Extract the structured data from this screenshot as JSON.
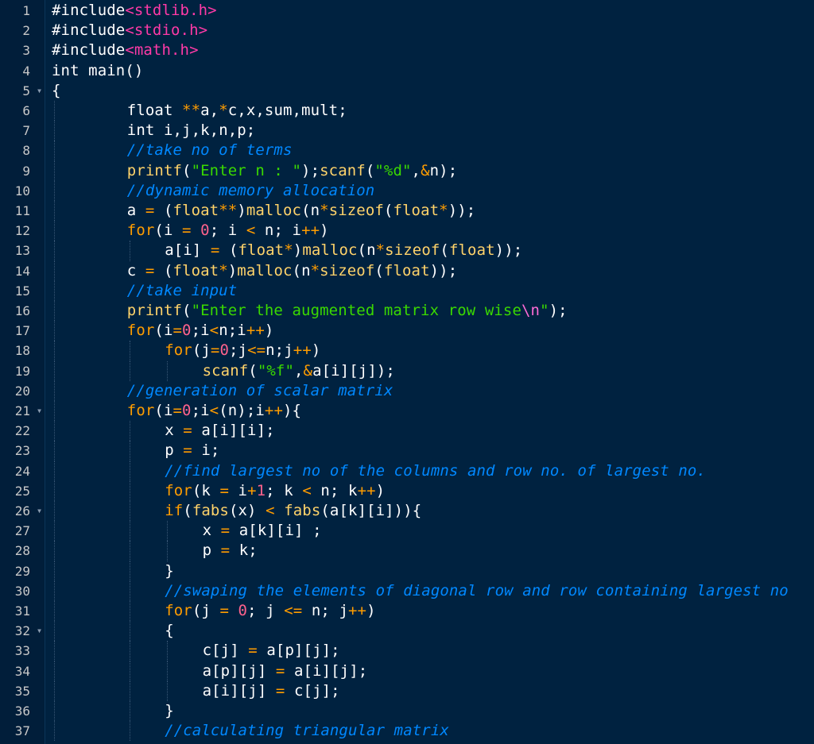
{
  "editor": {
    "theme_colors": {
      "background": "#002240",
      "gutter": "#011e3a",
      "text": "#ffffff",
      "keyword": "#ff9d00",
      "function": "#ffd36a",
      "string": "#3ad900",
      "number": "#ff628c",
      "header": "#ff3aa7",
      "comment": "#0088ff"
    },
    "lines": [
      {
        "number": "1",
        "fold": false,
        "indent": 0,
        "tokens": [
          {
            "t": "#include",
            "c": "preprocessor"
          },
          {
            "t": "<stdlib.h>",
            "c": "header"
          }
        ]
      },
      {
        "number": "2",
        "fold": false,
        "indent": 0,
        "tokens": [
          {
            "t": "#include",
            "c": "preprocessor"
          },
          {
            "t": "<stdio.h>",
            "c": "header"
          }
        ]
      },
      {
        "number": "3",
        "fold": false,
        "indent": 0,
        "tokens": [
          {
            "t": "#include",
            "c": "preprocessor"
          },
          {
            "t": "<math.h>",
            "c": "header"
          }
        ]
      },
      {
        "number": "4",
        "fold": false,
        "indent": 0,
        "tokens": [
          {
            "t": "int",
            "c": "type"
          },
          {
            "t": " ",
            "c": "text"
          },
          {
            "t": "main",
            "c": "identifier"
          },
          {
            "t": "()",
            "c": "text"
          }
        ]
      },
      {
        "number": "5",
        "fold": true,
        "indent": 0,
        "tokens": [
          {
            "t": "{",
            "c": "text"
          }
        ]
      },
      {
        "number": "6",
        "fold": false,
        "indent": 2,
        "tokens": [
          {
            "t": "float",
            "c": "type"
          },
          {
            "t": " ",
            "c": "text"
          },
          {
            "t": "**",
            "c": "operator"
          },
          {
            "t": "a,",
            "c": "text"
          },
          {
            "t": "*",
            "c": "operator"
          },
          {
            "t": "c,x,sum,mult;",
            "c": "text"
          }
        ]
      },
      {
        "number": "7",
        "fold": false,
        "indent": 2,
        "tokens": [
          {
            "t": "int",
            "c": "type"
          },
          {
            "t": " i,j,k,n,p;",
            "c": "text"
          }
        ]
      },
      {
        "number": "8",
        "fold": false,
        "indent": 2,
        "tokens": [
          {
            "t": "//take no of terms",
            "c": "comment"
          }
        ]
      },
      {
        "number": "9",
        "fold": false,
        "indent": 2,
        "tokens": [
          {
            "t": "printf",
            "c": "function"
          },
          {
            "t": "(",
            "c": "text"
          },
          {
            "t": "\"Enter n : \"",
            "c": "string"
          },
          {
            "t": ");",
            "c": "text"
          },
          {
            "t": "scanf",
            "c": "function"
          },
          {
            "t": "(",
            "c": "text"
          },
          {
            "t": "\"%d\"",
            "c": "string"
          },
          {
            "t": ",",
            "c": "text"
          },
          {
            "t": "&",
            "c": "operator"
          },
          {
            "t": "n);",
            "c": "text"
          }
        ]
      },
      {
        "number": "10",
        "fold": false,
        "indent": 2,
        "tokens": [
          {
            "t": "//dynamic memory allocation",
            "c": "comment"
          }
        ]
      },
      {
        "number": "11",
        "fold": false,
        "indent": 2,
        "tokens": [
          {
            "t": "a ",
            "c": "text"
          },
          {
            "t": "=",
            "c": "operator"
          },
          {
            "t": " (",
            "c": "text"
          },
          {
            "t": "float",
            "c": "function"
          },
          {
            "t": "**",
            "c": "operator"
          },
          {
            "t": ")",
            "c": "text"
          },
          {
            "t": "malloc",
            "c": "function"
          },
          {
            "t": "(n",
            "c": "text"
          },
          {
            "t": "*",
            "c": "operator"
          },
          {
            "t": "sizeof",
            "c": "function"
          },
          {
            "t": "(",
            "c": "text"
          },
          {
            "t": "float",
            "c": "function"
          },
          {
            "t": "*",
            "c": "operator"
          },
          {
            "t": "));",
            "c": "text"
          }
        ]
      },
      {
        "number": "12",
        "fold": false,
        "indent": 2,
        "tokens": [
          {
            "t": "for",
            "c": "keyword"
          },
          {
            "t": "(i ",
            "c": "text"
          },
          {
            "t": "=",
            "c": "operator"
          },
          {
            "t": " ",
            "c": "text"
          },
          {
            "t": "0",
            "c": "number"
          },
          {
            "t": "; i ",
            "c": "text"
          },
          {
            "t": "<",
            "c": "operator"
          },
          {
            "t": " n; i",
            "c": "text"
          },
          {
            "t": "++",
            "c": "operator"
          },
          {
            "t": ")",
            "c": "text"
          }
        ]
      },
      {
        "number": "13",
        "fold": false,
        "indent": 3,
        "tokens": [
          {
            "t": "a[i] ",
            "c": "text"
          },
          {
            "t": "=",
            "c": "operator"
          },
          {
            "t": " (",
            "c": "text"
          },
          {
            "t": "float",
            "c": "function"
          },
          {
            "t": "*",
            "c": "operator"
          },
          {
            "t": ")",
            "c": "text"
          },
          {
            "t": "malloc",
            "c": "function"
          },
          {
            "t": "(n",
            "c": "text"
          },
          {
            "t": "*",
            "c": "operator"
          },
          {
            "t": "sizeof",
            "c": "function"
          },
          {
            "t": "(",
            "c": "text"
          },
          {
            "t": "float",
            "c": "function"
          },
          {
            "t": "));",
            "c": "text"
          }
        ]
      },
      {
        "number": "14",
        "fold": false,
        "indent": 2,
        "tokens": [
          {
            "t": "c ",
            "c": "text"
          },
          {
            "t": "=",
            "c": "operator"
          },
          {
            "t": " (",
            "c": "text"
          },
          {
            "t": "float",
            "c": "function"
          },
          {
            "t": "*",
            "c": "operator"
          },
          {
            "t": ")",
            "c": "text"
          },
          {
            "t": "malloc",
            "c": "function"
          },
          {
            "t": "(n",
            "c": "text"
          },
          {
            "t": "*",
            "c": "operator"
          },
          {
            "t": "sizeof",
            "c": "function"
          },
          {
            "t": "(",
            "c": "text"
          },
          {
            "t": "float",
            "c": "function"
          },
          {
            "t": "));",
            "c": "text"
          }
        ]
      },
      {
        "number": "15",
        "fold": false,
        "indent": 2,
        "tokens": [
          {
            "t": "//take input",
            "c": "comment"
          }
        ]
      },
      {
        "number": "16",
        "fold": false,
        "indent": 2,
        "tokens": [
          {
            "t": "printf",
            "c": "function"
          },
          {
            "t": "(",
            "c": "text"
          },
          {
            "t": "\"Enter the augmented matrix row wise",
            "c": "string"
          },
          {
            "t": "\\n",
            "c": "escape"
          },
          {
            "t": "\"",
            "c": "string"
          },
          {
            "t": ");",
            "c": "text"
          }
        ]
      },
      {
        "number": "17",
        "fold": false,
        "indent": 2,
        "tokens": [
          {
            "t": "for",
            "c": "keyword"
          },
          {
            "t": "(i",
            "c": "text"
          },
          {
            "t": "=",
            "c": "operator"
          },
          {
            "t": "0",
            "c": "number"
          },
          {
            "t": ";i",
            "c": "text"
          },
          {
            "t": "<",
            "c": "operator"
          },
          {
            "t": "n;i",
            "c": "text"
          },
          {
            "t": "++",
            "c": "operator"
          },
          {
            "t": ")",
            "c": "text"
          }
        ]
      },
      {
        "number": "18",
        "fold": false,
        "indent": 3,
        "tokens": [
          {
            "t": "for",
            "c": "keyword"
          },
          {
            "t": "(j",
            "c": "text"
          },
          {
            "t": "=",
            "c": "operator"
          },
          {
            "t": "0",
            "c": "number"
          },
          {
            "t": ";j",
            "c": "text"
          },
          {
            "t": "<=",
            "c": "operator"
          },
          {
            "t": "n;j",
            "c": "text"
          },
          {
            "t": "++",
            "c": "operator"
          },
          {
            "t": ")",
            "c": "text"
          }
        ]
      },
      {
        "number": "19",
        "fold": false,
        "indent": 4,
        "tokens": [
          {
            "t": "scanf",
            "c": "function"
          },
          {
            "t": "(",
            "c": "text"
          },
          {
            "t": "\"%f\"",
            "c": "string"
          },
          {
            "t": ",",
            "c": "text"
          },
          {
            "t": "&",
            "c": "operator"
          },
          {
            "t": "a[i][j]);",
            "c": "text"
          }
        ]
      },
      {
        "number": "20",
        "fold": false,
        "indent": 2,
        "tokens": [
          {
            "t": "//generation of scalar matrix",
            "c": "comment"
          }
        ]
      },
      {
        "number": "21",
        "fold": true,
        "indent": 2,
        "tokens": [
          {
            "t": "for",
            "c": "keyword"
          },
          {
            "t": "(i",
            "c": "text"
          },
          {
            "t": "=",
            "c": "operator"
          },
          {
            "t": "0",
            "c": "number"
          },
          {
            "t": ";i",
            "c": "text"
          },
          {
            "t": "<",
            "c": "operator"
          },
          {
            "t": "(n);i",
            "c": "text"
          },
          {
            "t": "++",
            "c": "operator"
          },
          {
            "t": "){",
            "c": "text"
          }
        ]
      },
      {
        "number": "22",
        "fold": false,
        "indent": 3,
        "tokens": [
          {
            "t": "x ",
            "c": "text"
          },
          {
            "t": "=",
            "c": "operator"
          },
          {
            "t": " a[i][i];",
            "c": "text"
          }
        ]
      },
      {
        "number": "23",
        "fold": false,
        "indent": 3,
        "tokens": [
          {
            "t": "p ",
            "c": "text"
          },
          {
            "t": "=",
            "c": "operator"
          },
          {
            "t": " i;",
            "c": "text"
          }
        ]
      },
      {
        "number": "24",
        "fold": false,
        "indent": 3,
        "tokens": [
          {
            "t": "//find largest no of the columns and row no. of largest no.",
            "c": "comment"
          }
        ]
      },
      {
        "number": "25",
        "fold": false,
        "indent": 3,
        "tokens": [
          {
            "t": "for",
            "c": "keyword"
          },
          {
            "t": "(k ",
            "c": "text"
          },
          {
            "t": "=",
            "c": "operator"
          },
          {
            "t": " i",
            "c": "text"
          },
          {
            "t": "+",
            "c": "operator"
          },
          {
            "t": "1",
            "c": "number"
          },
          {
            "t": "; k ",
            "c": "text"
          },
          {
            "t": "<",
            "c": "operator"
          },
          {
            "t": " n; k",
            "c": "text"
          },
          {
            "t": "++",
            "c": "operator"
          },
          {
            "t": ")",
            "c": "text"
          }
        ]
      },
      {
        "number": "26",
        "fold": true,
        "indent": 3,
        "tokens": [
          {
            "t": "if",
            "c": "keyword"
          },
          {
            "t": "(",
            "c": "text"
          },
          {
            "t": "fabs",
            "c": "function"
          },
          {
            "t": "(x) ",
            "c": "text"
          },
          {
            "t": "<",
            "c": "operator"
          },
          {
            "t": " ",
            "c": "text"
          },
          {
            "t": "fabs",
            "c": "function"
          },
          {
            "t": "(a[k][i])){",
            "c": "text"
          }
        ]
      },
      {
        "number": "27",
        "fold": false,
        "indent": 4,
        "tokens": [
          {
            "t": "x ",
            "c": "text"
          },
          {
            "t": "=",
            "c": "operator"
          },
          {
            "t": " a[k][i] ;",
            "c": "text"
          }
        ]
      },
      {
        "number": "28",
        "fold": false,
        "indent": 4,
        "tokens": [
          {
            "t": "p ",
            "c": "text"
          },
          {
            "t": "=",
            "c": "operator"
          },
          {
            "t": " k;",
            "c": "text"
          }
        ]
      },
      {
        "number": "29",
        "fold": false,
        "indent": 3,
        "tokens": [
          {
            "t": "}",
            "c": "text"
          }
        ]
      },
      {
        "number": "30",
        "fold": false,
        "indent": 3,
        "tokens": [
          {
            "t": "//swaping the elements of diagonal row and row containing largest no",
            "c": "comment"
          }
        ]
      },
      {
        "number": "31",
        "fold": false,
        "indent": 3,
        "tokens": [
          {
            "t": "for",
            "c": "keyword"
          },
          {
            "t": "(j ",
            "c": "text"
          },
          {
            "t": "=",
            "c": "operator"
          },
          {
            "t": " ",
            "c": "text"
          },
          {
            "t": "0",
            "c": "number"
          },
          {
            "t": "; j ",
            "c": "text"
          },
          {
            "t": "<=",
            "c": "operator"
          },
          {
            "t": " n; j",
            "c": "text"
          },
          {
            "t": "++",
            "c": "operator"
          },
          {
            "t": ")",
            "c": "text"
          }
        ]
      },
      {
        "number": "32",
        "fold": true,
        "indent": 3,
        "tokens": [
          {
            "t": "{",
            "c": "text"
          }
        ]
      },
      {
        "number": "33",
        "fold": false,
        "indent": 4,
        "tokens": [
          {
            "t": "c[j] ",
            "c": "text"
          },
          {
            "t": "=",
            "c": "operator"
          },
          {
            "t": " a[p][j];",
            "c": "text"
          }
        ]
      },
      {
        "number": "34",
        "fold": false,
        "indent": 4,
        "tokens": [
          {
            "t": "a[p][j] ",
            "c": "text"
          },
          {
            "t": "=",
            "c": "operator"
          },
          {
            "t": " a[i][j];",
            "c": "text"
          }
        ]
      },
      {
        "number": "35",
        "fold": false,
        "indent": 4,
        "tokens": [
          {
            "t": "a[i][j] ",
            "c": "text"
          },
          {
            "t": "=",
            "c": "operator"
          },
          {
            "t": " c[j];",
            "c": "text"
          }
        ]
      },
      {
        "number": "36",
        "fold": false,
        "indent": 3,
        "tokens": [
          {
            "t": "}",
            "c": "text"
          }
        ]
      },
      {
        "number": "37",
        "fold": false,
        "indent": 3,
        "tokens": [
          {
            "t": "//calculating triangular matrix",
            "c": "comment"
          }
        ]
      }
    ]
  }
}
